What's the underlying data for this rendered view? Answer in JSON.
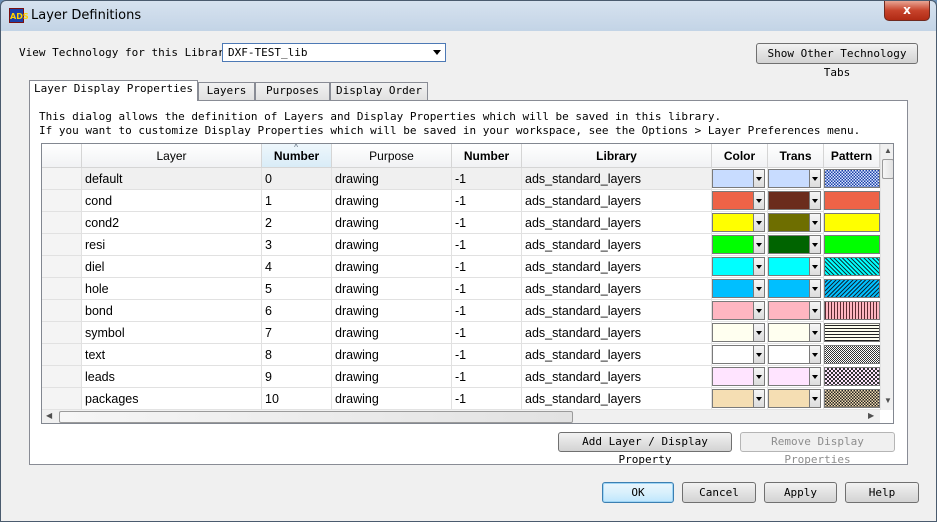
{
  "window": {
    "title": "Layer Definitions",
    "close_label": "x",
    "icon_label": "ADS"
  },
  "technology": {
    "label": "View Technology for this Library:",
    "value": "DXF-TEST_lib",
    "show_tabs_button": "Show Other Technology Tabs"
  },
  "tabs": [
    {
      "label": "Layer Display Properties",
      "active": true
    },
    {
      "label": "Layers",
      "active": false
    },
    {
      "label": "Purposes",
      "active": false
    },
    {
      "label": "Display Order",
      "active": false
    }
  ],
  "description": {
    "line1": "This dialog allows the definition of Layers and Display Properties which will be saved in this library.",
    "line2": "If you want to customize Display Properties which will be saved in your workspace, see the Options > Layer Preferences menu."
  },
  "table": {
    "columns": [
      "Layer",
      "Number",
      "Purpose",
      "Number",
      "Library",
      "Color",
      "Trans",
      "Pattern"
    ],
    "rows": [
      {
        "layer": "default",
        "number": "0",
        "purpose": "drawing",
        "pnum": "-1",
        "library": "ads_standard_layers",
        "color": "#c8dcff",
        "trans": "#c8dcff",
        "pattern": "dots-blue"
      },
      {
        "layer": "cond",
        "number": "1",
        "purpose": "drawing",
        "pnum": "-1",
        "library": "ads_standard_layers",
        "color": "#ee6347",
        "trans": "#6b2c1c",
        "pattern": "solid-red"
      },
      {
        "layer": "cond2",
        "number": "2",
        "purpose": "drawing",
        "pnum": "-1",
        "library": "ads_standard_layers",
        "color": "#ffff00",
        "trans": "#6e6e00",
        "pattern": "solid-yellow"
      },
      {
        "layer": "resi",
        "number": "3",
        "purpose": "drawing",
        "pnum": "-1",
        "library": "ads_standard_layers",
        "color": "#00ff00",
        "trans": "#006400",
        "pattern": "solid-green"
      },
      {
        "layer": "diel",
        "number": "4",
        "purpose": "drawing",
        "pnum": "-1",
        "library": "ads_standard_layers",
        "color": "#00ffff",
        "trans": "#00ffff",
        "pattern": "diagonal-cyan"
      },
      {
        "layer": "hole",
        "number": "5",
        "purpose": "drawing",
        "pnum": "-1",
        "library": "ads_standard_layers",
        "color": "#00bfff",
        "trans": "#00bfff",
        "pattern": "diagonal-blue"
      },
      {
        "layer": "bond",
        "number": "6",
        "purpose": "drawing",
        "pnum": "-1",
        "library": "ads_standard_layers",
        "color": "#ffb6c1",
        "trans": "#ffb6c1",
        "pattern": "vertical-lines"
      },
      {
        "layer": "symbol",
        "number": "7",
        "purpose": "drawing",
        "pnum": "-1",
        "library": "ads_standard_layers",
        "color": "#fffff0",
        "trans": "#fffff0",
        "pattern": "horizontal-lines"
      },
      {
        "layer": "text",
        "number": "8",
        "purpose": "drawing",
        "pnum": "-1",
        "library": "ads_standard_layers",
        "color": "#ffffff",
        "trans": "#ffffff",
        "pattern": "checker-fine"
      },
      {
        "layer": "leads",
        "number": "9",
        "purpose": "drawing",
        "pnum": "-1",
        "library": "ads_standard_layers",
        "color": "#ffe4ff",
        "trans": "#ffe4ff",
        "pattern": "checker"
      },
      {
        "layer": "packages",
        "number": "10",
        "purpose": "drawing",
        "pnum": "-1",
        "library": "ads_standard_layers",
        "color": "#f5deb3",
        "trans": "#f5deb3",
        "pattern": "checker-dense"
      }
    ]
  },
  "actions": {
    "add": "Add Layer / Display Property",
    "remove": "Remove Display Properties"
  },
  "footer": {
    "ok": "OK",
    "cancel": "Cancel",
    "apply": "Apply",
    "help": "Help"
  }
}
